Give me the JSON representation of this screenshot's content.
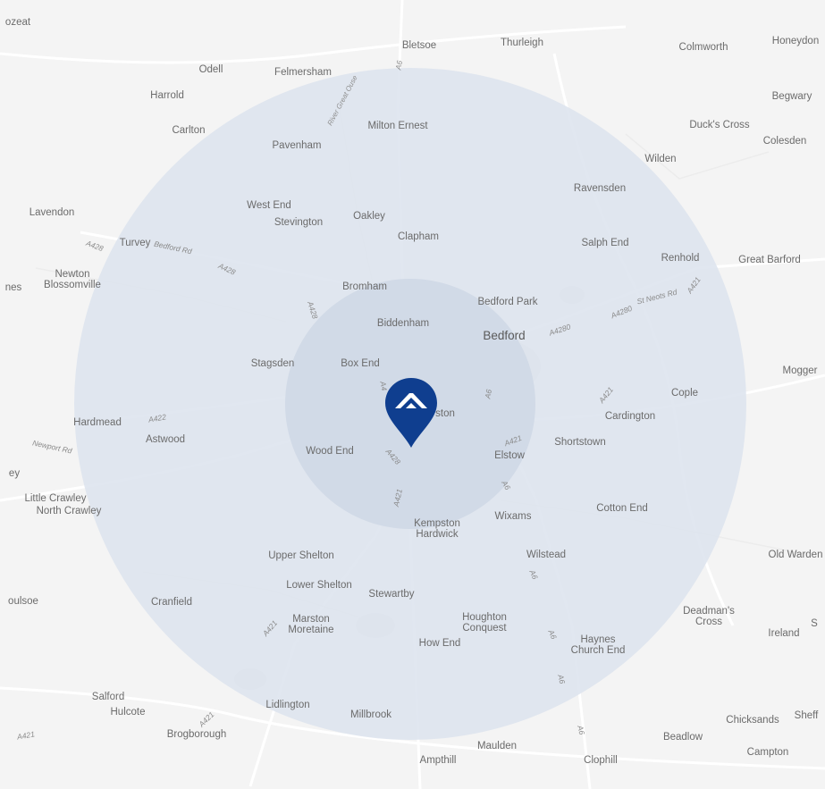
{
  "map": {
    "colors": {
      "land": "#f4f4f4",
      "outer_radius": "#dde4ee",
      "inner_radius": "#cfd8e6",
      "pin": "#0f3e8f",
      "pin_icon": "#ffffff"
    },
    "radius_rings": [
      "outer",
      "inner"
    ],
    "pin_icon": "house-roof-icon",
    "places": [
      {
        "id": "bozeat",
        "label": "ozeat"
      },
      {
        "id": "bletsoe",
        "label": "Bletsoe"
      },
      {
        "id": "thurleigh",
        "label": "Thurleigh"
      },
      {
        "id": "colmworth",
        "label": "Colmworth"
      },
      {
        "id": "honeydon",
        "label": "Honeydon"
      },
      {
        "id": "odell",
        "label": "Odell"
      },
      {
        "id": "felmersham",
        "label": "Felmersham"
      },
      {
        "id": "harrold",
        "label": "Harrold"
      },
      {
        "id": "begwary",
        "label": "Begwary"
      },
      {
        "id": "milton-ernest",
        "label": "Milton Ernest"
      },
      {
        "id": "carlton",
        "label": "Carlton"
      },
      {
        "id": "ducks-cross",
        "label": "Duck's Cross"
      },
      {
        "id": "colesden",
        "label": "Colesden"
      },
      {
        "id": "pavenham",
        "label": "Pavenham"
      },
      {
        "id": "wilden",
        "label": "Wilden"
      },
      {
        "id": "ravensden",
        "label": "Ravensden"
      },
      {
        "id": "west-end",
        "label": "West End"
      },
      {
        "id": "lavendon",
        "label": "Lavendon"
      },
      {
        "id": "oakley",
        "label": "Oakley"
      },
      {
        "id": "stevington",
        "label": "Stevington"
      },
      {
        "id": "clapham",
        "label": "Clapham"
      },
      {
        "id": "salph-end",
        "label": "Salph End"
      },
      {
        "id": "turvey",
        "label": "Turvey"
      },
      {
        "id": "renhold",
        "label": "Renhold"
      },
      {
        "id": "great-barford",
        "label": "Great Barford"
      },
      {
        "id": "newton-blossomville",
        "label": "Newton\nBlossomville"
      },
      {
        "id": "nes",
        "label": "nes"
      },
      {
        "id": "bromham",
        "label": "Bromham"
      },
      {
        "id": "bedford-park",
        "label": "Bedford Park"
      },
      {
        "id": "biddenham",
        "label": "Biddenham"
      },
      {
        "id": "bedford",
        "label": "Bedford",
        "big": true
      },
      {
        "id": "stagsden",
        "label": "Stagsden"
      },
      {
        "id": "box-end",
        "label": "Box End"
      },
      {
        "id": "mogger",
        "label": "Mogger"
      },
      {
        "id": "cople",
        "label": "Cople"
      },
      {
        "id": "kempston",
        "label": "ston"
      },
      {
        "id": "cardington",
        "label": "Cardington"
      },
      {
        "id": "hardmead",
        "label": "Hardmead"
      },
      {
        "id": "astwood",
        "label": "Astwood"
      },
      {
        "id": "shortstown",
        "label": "Shortstown"
      },
      {
        "id": "wood-end",
        "label": "Wood End"
      },
      {
        "id": "elstow",
        "label": "Elstow"
      },
      {
        "id": "ey",
        "label": "ey"
      },
      {
        "id": "little-crawley",
        "label": "Little Crawley"
      },
      {
        "id": "north-crawley",
        "label": "North Crawley"
      },
      {
        "id": "cotton-end",
        "label": "Cotton End"
      },
      {
        "id": "wixams",
        "label": "Wixams"
      },
      {
        "id": "kempston-hardwick",
        "label": "Kempston\nHardwick"
      },
      {
        "id": "upper-shelton",
        "label": "Upper Shelton"
      },
      {
        "id": "wilstead",
        "label": "Wilstead"
      },
      {
        "id": "old-warden",
        "label": "Old Warden"
      },
      {
        "id": "lower-shelton",
        "label": "Lower Shelton"
      },
      {
        "id": "stewartby",
        "label": "Stewartby"
      },
      {
        "id": "moulsoe",
        "label": "oulsoe"
      },
      {
        "id": "cranfield",
        "label": "Cranfield"
      },
      {
        "id": "deadmans-cross",
        "label": "Deadman's\nCross"
      },
      {
        "id": "marston-moretaine",
        "label": "Marston\nMoretaine"
      },
      {
        "id": "houghton-conquest",
        "label": "Houghton\nConquest"
      },
      {
        "id": "ireland",
        "label": "Ireland"
      },
      {
        "id": "s-edge",
        "label": "S"
      },
      {
        "id": "haynes-church-end",
        "label": "Haynes\nChurch End"
      },
      {
        "id": "how-end",
        "label": "How End"
      },
      {
        "id": "salford",
        "label": "Salford"
      },
      {
        "id": "hulcote",
        "label": "Hulcote"
      },
      {
        "id": "lidlington",
        "label": "Lidlington"
      },
      {
        "id": "millbrook",
        "label": "Millbrook"
      },
      {
        "id": "chicksands",
        "label": "Chicksands"
      },
      {
        "id": "shefford",
        "label": "Sheff"
      },
      {
        "id": "brogborough",
        "label": "Brogborough"
      },
      {
        "id": "beadlow",
        "label": "Beadlow"
      },
      {
        "id": "maulden",
        "label": "Maulden"
      },
      {
        "id": "campton",
        "label": "Campton"
      },
      {
        "id": "ampthill",
        "label": "Ampthill"
      },
      {
        "id": "clophill",
        "label": "Clophill"
      }
    ],
    "road_labels": [
      {
        "id": "a6-bletsoe",
        "label": "A6"
      },
      {
        "id": "river-great-ouse",
        "label": "River Great Ouse",
        "river": true
      },
      {
        "id": "a428-west",
        "label": "A428"
      },
      {
        "id": "bedford-rd",
        "label": "Bedford Rd"
      },
      {
        "id": "a428-turvey",
        "label": "A428"
      },
      {
        "id": "a428-bromham",
        "label": "A428"
      },
      {
        "id": "a4280",
        "label": "A4280"
      },
      {
        "id": "a4280-st-neots",
        "label": "A4280"
      },
      {
        "id": "st-neots-rd",
        "label": "St Neots Rd"
      },
      {
        "id": "a421-renhold",
        "label": "A421"
      },
      {
        "id": "a6-bedford",
        "label": "A6"
      },
      {
        "id": "a4-kempston",
        "label": "A4"
      },
      {
        "id": "a421-cardington",
        "label": "A421"
      },
      {
        "id": "a422",
        "label": "A422"
      },
      {
        "id": "newport-rd",
        "label": "Newport Rd"
      },
      {
        "id": "a421-elstow",
        "label": "A421"
      },
      {
        "id": "a428-kempston",
        "label": "A428"
      },
      {
        "id": "a6-elstow",
        "label": "A6"
      },
      {
        "id": "a421-south",
        "label": "A421"
      },
      {
        "id": "a6-wilstead",
        "label": "A6"
      },
      {
        "id": "a421-marston",
        "label": "A421"
      },
      {
        "id": "a6-haynes",
        "label": "A6"
      },
      {
        "id": "a6-haynes-south",
        "label": "A6"
      },
      {
        "id": "a421-brogborough",
        "label": "A421"
      },
      {
        "id": "a421-west",
        "label": "A421"
      },
      {
        "id": "a6-beadlow",
        "label": "A6"
      }
    ]
  }
}
